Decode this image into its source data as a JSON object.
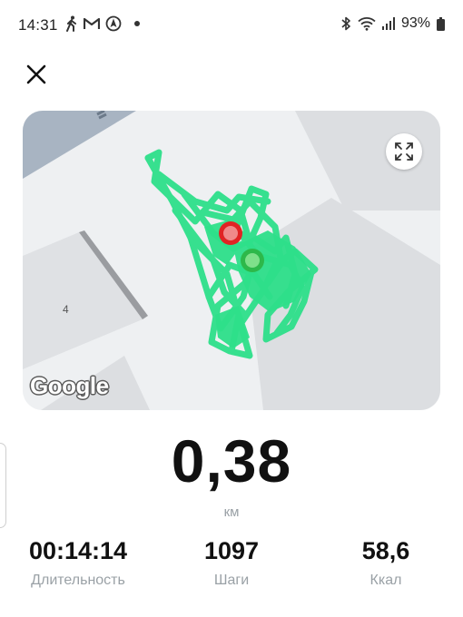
{
  "status_bar": {
    "time": "14:31",
    "battery_percent": "93%",
    "icons_left": [
      "walking-icon",
      "gmail-icon",
      "navigation-app-icon",
      "notification-dot"
    ],
    "icons_right": [
      "bluetooth-icon",
      "wifi-icon",
      "signal-icon",
      "battery-icon"
    ]
  },
  "header": {
    "close_icon": "close-icon"
  },
  "map": {
    "attribution": "Google",
    "building_number": "4",
    "expand_icon": "expand-icon",
    "route_color": "#2ee08a",
    "start_marker_color": "#e02424",
    "end_marker_color": "#2db84a"
  },
  "summary": {
    "distance": "0,38",
    "distance_unit": "км"
  },
  "stats": {
    "duration": {
      "value": "00:14:14",
      "label": "Длительность"
    },
    "steps": {
      "value": "1097",
      "label": "Шаги"
    },
    "kcal": {
      "value": "58,6",
      "label": "Ккал"
    }
  }
}
